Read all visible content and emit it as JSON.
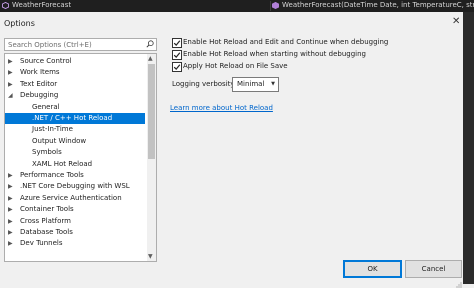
{
  "topbar": {
    "left_label": "WeatherForecast",
    "right_label": "WeatherForecast(DateTime Date, int TemperatureC, str"
  },
  "dialog": {
    "title": "Options",
    "close_glyph": "✕"
  },
  "search": {
    "placeholder": "Search Options (Ctrl+E)"
  },
  "tree": {
    "items": [
      {
        "label": "Source Control",
        "arrow": "▶",
        "level": 0
      },
      {
        "label": "Work Items",
        "arrow": "▶",
        "level": 0
      },
      {
        "label": "Text Editor",
        "arrow": "▶",
        "level": 0
      },
      {
        "label": "Debugging",
        "arrow": "◢",
        "level": 0
      },
      {
        "label": "General",
        "arrow": "",
        "level": 1
      },
      {
        "label": ".NET / C++ Hot Reload",
        "arrow": "",
        "level": 1,
        "selected": true
      },
      {
        "label": "Just-In-Time",
        "arrow": "",
        "level": 1
      },
      {
        "label": "Output Window",
        "arrow": "",
        "level": 1
      },
      {
        "label": "Symbols",
        "arrow": "",
        "level": 1
      },
      {
        "label": "XAML Hot Reload",
        "arrow": "",
        "level": 1
      },
      {
        "label": "Performance Tools",
        "arrow": "▶",
        "level": 0
      },
      {
        "label": ".NET Core Debugging with WSL",
        "arrow": "▶",
        "level": 0
      },
      {
        "label": "Azure Service Authentication",
        "arrow": "▶",
        "level": 0
      },
      {
        "label": "Container Tools",
        "arrow": "▶",
        "level": 0
      },
      {
        "label": "Cross Platform",
        "arrow": "▶",
        "level": 0
      },
      {
        "label": "Database Tools",
        "arrow": "▶",
        "level": 0
      },
      {
        "label": "Dev Tunnels",
        "arrow": "▶",
        "level": 0
      }
    ]
  },
  "options": {
    "checkboxes": [
      {
        "label": "Enable Hot Reload and Edit and Continue when debugging",
        "checked": true
      },
      {
        "label": "Enable Hot Reload when starting without debugging",
        "checked": true
      },
      {
        "label": "Apply Hot Reload on File Save",
        "checked": true
      }
    ],
    "verbosity_label": "Logging verbosity",
    "verbosity_value": "Minimal",
    "learn_more": "Learn more about Hot Reload"
  },
  "buttons": {
    "ok": "OK",
    "cancel": "Cancel"
  }
}
